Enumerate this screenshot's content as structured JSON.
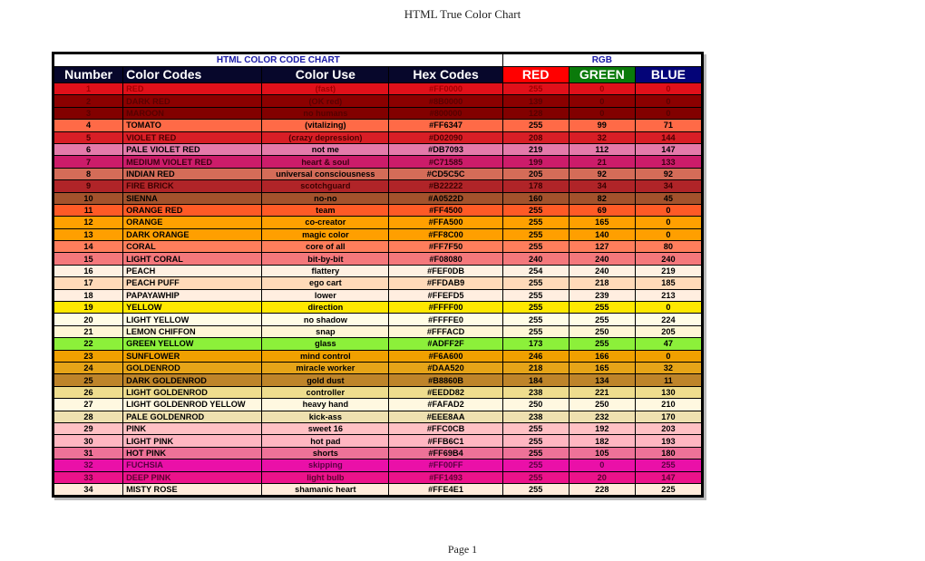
{
  "page_header": "HTML True Color Chart",
  "page_footer": "Page 1",
  "table": {
    "group_title": "HTML COLOR CODE CHART",
    "rgb_title": "RGB",
    "columns": [
      "Number",
      "Color Codes",
      "Color Use",
      "Hex Codes",
      "RED",
      "GREEN",
      "BLUE"
    ],
    "header_colors": {
      "red": "#FF0000",
      "green": "#0A7A0A",
      "blue": "#040478",
      "dark": "#07072B"
    },
    "rows": [
      {
        "num": "1",
        "name": "RED",
        "use": "(fast)",
        "hex": "#FF0000",
        "r": "255",
        "g": "0",
        "b": "0",
        "bg": "#E0101A",
        "fg": "#A00000"
      },
      {
        "num": "2",
        "name": "DARK RED",
        "use": "(OK red)",
        "hex": "#8B0000",
        "r": "139",
        "g": "0",
        "b": "0",
        "bg": "#8B0000",
        "fg": "#5A0000"
      },
      {
        "num": "3",
        "name": "MAROON",
        "use": "no humans",
        "hex": "#800000",
        "r": "128",
        "g": "0",
        "b": "0",
        "bg": "#820000",
        "fg": "#550000"
      },
      {
        "num": "4",
        "name": "TOMATO",
        "use": "(vitalizing)",
        "hex": "#FF6347",
        "r": "255",
        "g": "99",
        "b": "71",
        "bg": "#FF6A47",
        "fg": "#000000"
      },
      {
        "num": "5",
        "name": "VIOLET RED",
        "use": "(crazy depression)",
        "hex": "#D02090",
        "r": "208",
        "g": "32",
        "b": "144",
        "bg": "#D81E26",
        "fg": "#4A0000"
      },
      {
        "num": "6",
        "name": "PALE VIOLET RED",
        "use": "not me",
        "hex": "#DB7093",
        "r": "219",
        "g": "112",
        "b": "147",
        "bg": "#E47AAA",
        "fg": "#000000"
      },
      {
        "num": "7",
        "name": "MEDIUM VIOLET RED",
        "use": "heart & soul",
        "hex": "#C71585",
        "r": "199",
        "g": "21",
        "b": "133",
        "bg": "#CC1C6A",
        "fg": "#3A0010"
      },
      {
        "num": "8",
        "name": "INDIAN RED",
        "use": "universal consciousness",
        "hex": "#CD5C5C",
        "r": "205",
        "g": "92",
        "b": "92",
        "bg": "#D46C58",
        "fg": "#000000"
      },
      {
        "num": "9",
        "name": "FIRE BRICK",
        "use": "scotchguard",
        "hex": "#B22222",
        "r": "178",
        "g": "34",
        "b": "34",
        "bg": "#B02428",
        "fg": "#3A0000"
      },
      {
        "num": "10",
        "name": "SIENNA",
        "use": "no-no",
        "hex": "#A0522D",
        "r": "160",
        "g": "82",
        "b": "45",
        "bg": "#A3522C",
        "fg": "#000000"
      },
      {
        "num": "11",
        "name": "ORANGE RED",
        "use": "team",
        "hex": "#FF4500",
        "r": "255",
        "g": "69",
        "b": "0",
        "bg": "#FF5A26",
        "fg": "#000000"
      },
      {
        "num": "12",
        "name": "ORANGE",
        "use": "co-creator",
        "hex": "#FFA500",
        "r": "255",
        "g": "165",
        "b": "0",
        "bg": "#FFA000",
        "fg": "#000000"
      },
      {
        "num": "13",
        "name": "DARK ORANGE",
        "use": "magic color",
        "hex": "#FF8C00",
        "r": "255",
        "g": "140",
        "b": "0",
        "bg": "#FF9F00",
        "fg": "#000000"
      },
      {
        "num": "14",
        "name": "CORAL",
        "use": "core of all",
        "hex": "#FF7F50",
        "r": "255",
        "g": "127",
        "b": "80",
        "bg": "#FF7E5C",
        "fg": "#000000"
      },
      {
        "num": "15",
        "name": "LIGHT CORAL",
        "use": "bit-by-bit",
        "hex": "#F08080",
        "r": "240",
        "g": "240",
        "b": "240",
        "bg": "#F4787C",
        "fg": "#000000"
      },
      {
        "num": "16",
        "name": "PEACH",
        "use": "flattery",
        "hex": "#FEF0DB",
        "r": "254",
        "g": "240",
        "b": "219",
        "bg": "#FEF0E2",
        "fg": "#000000"
      },
      {
        "num": "17",
        "name": "PEACH PUFF",
        "use": "ego cart",
        "hex": "#FFDAB9",
        "r": "255",
        "g": "218",
        "b": "185",
        "bg": "#FFDAB9",
        "fg": "#000000"
      },
      {
        "num": "18",
        "name": "PAPAYAWHIP",
        "use": "lower",
        "hex": "#FFEFD5",
        "r": "255",
        "g": "239",
        "b": "213",
        "bg": "#FFEEE0",
        "fg": "#000000"
      },
      {
        "num": "19",
        "name": "YELLOW",
        "use": "direction",
        "hex": "#FFFF00",
        "r": "255",
        "g": "255",
        "b": "0",
        "bg": "#FFE800",
        "fg": "#000000"
      },
      {
        "num": "20",
        "name": "LIGHT YELLOW",
        "use": "no shadow",
        "hex": "#FFFFE0",
        "r": "255",
        "g": "255",
        "b": "224",
        "bg": "#FFFDE6",
        "fg": "#000000"
      },
      {
        "num": "21",
        "name": "LEMON CHIFFON",
        "use": "snap",
        "hex": "#FFFACD",
        "r": "255",
        "g": "250",
        "b": "205",
        "bg": "#FFF6D6",
        "fg": "#000000"
      },
      {
        "num": "22",
        "name": "GREEN YELLOW",
        "use": "glass",
        "hex": "#ADFF2F",
        "r": "173",
        "g": "255",
        "b": "47",
        "bg": "#8CF03A",
        "fg": "#000000"
      },
      {
        "num": "23",
        "name": "SUNFLOWER",
        "use": "mind control",
        "hex": "#F6A600",
        "r": "246",
        "g": "166",
        "b": "0",
        "bg": "#F0A000",
        "fg": "#000000"
      },
      {
        "num": "24",
        "name": "GOLDENROD",
        "use": "miracle worker",
        "hex": "#DAA520",
        "r": "218",
        "g": "165",
        "b": "32",
        "bg": "#E6A418",
        "fg": "#000000"
      },
      {
        "num": "25",
        "name": "DARK GOLDENROD",
        "use": "gold dust",
        "hex": "#B8860B",
        "r": "184",
        "g": "134",
        "b": "11",
        "bg": "#BE842A",
        "fg": "#000000"
      },
      {
        "num": "26",
        "name": "LIGHT GOLDENROD",
        "use": "controller",
        "hex": "#EEDD82",
        "r": "238",
        "g": "221",
        "b": "130",
        "bg": "#EEDD8E",
        "fg": "#000000"
      },
      {
        "num": "27",
        "name": "LIGHT GOLDENROD YELLOW",
        "use": "heavy hand",
        "hex": "#FAFAD2",
        "r": "250",
        "g": "250",
        "b": "210",
        "bg": "#FFF8E0",
        "fg": "#000000"
      },
      {
        "num": "28",
        "name": "PALE GOLDENROD",
        "use": "kick-ass",
        "hex": "#EEE8AA",
        "r": "238",
        "g": "232",
        "b": "170",
        "bg": "#EEE0B0",
        "fg": "#000000"
      },
      {
        "num": "29",
        "name": "PINK",
        "use": "sweet 16",
        "hex": "#FFC0CB",
        "r": "255",
        "g": "192",
        "b": "203",
        "bg": "#FFC0C4",
        "fg": "#000000"
      },
      {
        "num": "30",
        "name": "LIGHT PINK",
        "use": "hot pad",
        "hex": "#FFB6C1",
        "r": "255",
        "g": "182",
        "b": "193",
        "bg": "#FFB6C1",
        "fg": "#000000"
      },
      {
        "num": "31",
        "name": "HOT PINK",
        "use": "shorts",
        "hex": "#FF69B4",
        "r": "255",
        "g": "105",
        "b": "180",
        "bg": "#EE7298",
        "fg": "#000000"
      },
      {
        "num": "32",
        "name": "FUCHSIA",
        "use": "skipping",
        "hex": "#FF00FF",
        "r": "255",
        "g": "0",
        "b": "255",
        "bg": "#EA10A8",
        "fg": "#5A0040"
      },
      {
        "num": "33",
        "name": "DEEP PINK",
        "use": "light bulb",
        "hex": "#FF1493",
        "r": "255",
        "g": "20",
        "b": "147",
        "bg": "#EC128A",
        "fg": "#5A0030"
      },
      {
        "num": "34",
        "name": "MISTY ROSE",
        "use": "shamanic heart",
        "hex": "#FFE4E1",
        "r": "255",
        "g": "228",
        "b": "225",
        "bg": "#FFEBDA",
        "fg": "#000000"
      }
    ]
  }
}
